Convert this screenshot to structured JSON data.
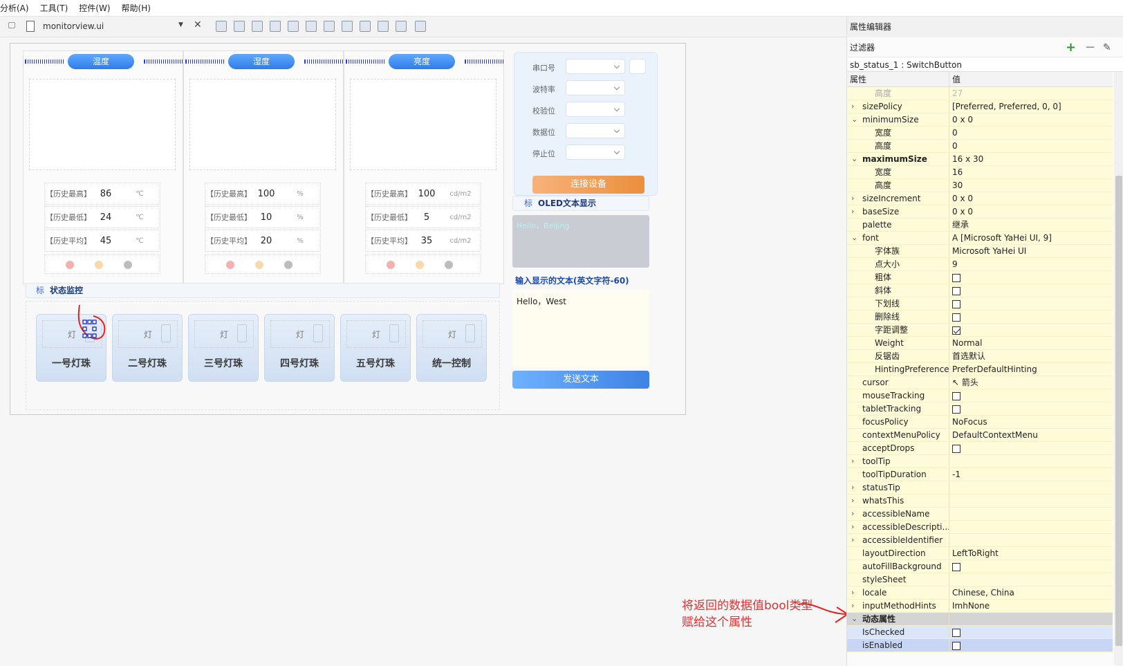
{
  "menu": [
    "分析(A)",
    "工具(T)",
    "控件(W)",
    "帮助(H)"
  ],
  "file": {
    "name": "monitorview.ui"
  },
  "cards": [
    {
      "title": "温度",
      "stats": [
        {
          "key": "【历史最高】",
          "value": "86",
          "unit": "℃"
        },
        {
          "key": "【历史最低】",
          "value": "24",
          "unit": "℃"
        },
        {
          "key": "【历史平均】",
          "value": "45",
          "unit": "℃"
        }
      ]
    },
    {
      "title": "湿度",
      "stats": [
        {
          "key": "【历史最高】",
          "value": "100",
          "unit": "%"
        },
        {
          "key": "【历史最低】",
          "value": "10",
          "unit": "%"
        },
        {
          "key": "【历史平均】",
          "value": "20",
          "unit": "%"
        }
      ]
    },
    {
      "title": "亮度",
      "stats": [
        {
          "key": "【历史最高】",
          "value": "100",
          "unit": "cd/m2"
        },
        {
          "key": "【历史最低】",
          "value": "5",
          "unit": "cd/m2"
        },
        {
          "key": "【历史平均】",
          "value": "35",
          "unit": "cd/m2"
        }
      ]
    }
  ],
  "dot_colors": [
    "#f3b0b0",
    "#f9d8ae",
    "#bdbdbd"
  ],
  "serial": {
    "labels": [
      "串口号",
      "波特率",
      "校验位",
      "数据位",
      "停止位"
    ],
    "connect": "连接设备"
  },
  "oled": {
    "title_icon": "标",
    "title": "OLED文本显示",
    "screen": "Hello，Beijing",
    "input_label": "输入显示的文本(英文字符-60)",
    "input_value": "Hello，West",
    "send": "发送文本"
  },
  "status": {
    "title_icon": "标",
    "title": "状态监控",
    "lamp_label": "灯",
    "buttons": [
      "一号灯珠",
      "二号灯珠",
      "三号灯珠",
      "四号灯珠",
      "五号灯珠",
      "统一控制"
    ]
  },
  "props": {
    "panel_title": "属性编辑器",
    "filter_label": "过滤器",
    "object": "sb_status_1 : SwitchButton",
    "col_name": "属性",
    "col_value": "值",
    "rows": [
      {
        "n": "高度",
        "v": "27",
        "ind": 2,
        "cb": "",
        "dim": true
      },
      {
        "n": "sizePolicy",
        "v": "[Preferred, Preferred, 0, 0]",
        "ind": 1,
        "arrow": "›",
        "cb": ""
      },
      {
        "n": "minimumSize",
        "v": "0 x 0",
        "ind": 1,
        "arrow": "⌄",
        "cb": ""
      },
      {
        "n": "宽度",
        "v": "0",
        "ind": 2,
        "cb": ""
      },
      {
        "n": "高度",
        "v": "0",
        "ind": 2,
        "cb": ""
      },
      {
        "n": "maximumSize",
        "v": "16 x 30",
        "ind": 1,
        "arrow": "⌄",
        "bold": true,
        "cb": ""
      },
      {
        "n": "宽度",
        "v": "16",
        "ind": 2,
        "cb": ""
      },
      {
        "n": "高度",
        "v": "30",
        "ind": 2,
        "cb": ""
      },
      {
        "n": "sizeIncrement",
        "v": "0 x 0",
        "ind": 1,
        "arrow": "›",
        "cb": ""
      },
      {
        "n": "baseSize",
        "v": "0 x 0",
        "ind": 1,
        "arrow": "›",
        "cb": ""
      },
      {
        "n": "palette",
        "v": "继承",
        "ind": 1,
        "cb": ""
      },
      {
        "n": "font",
        "v": "A  [Microsoft YaHei UI, 9]",
        "ind": 1,
        "arrow": "⌄",
        "cb": ""
      },
      {
        "n": "字体族",
        "v": "Microsoft YaHei UI",
        "ind": 2,
        "cb": ""
      },
      {
        "n": "点大小",
        "v": "9",
        "ind": 2,
        "cb": ""
      },
      {
        "n": "粗体",
        "v": "",
        "ind": 2,
        "cb": "off"
      },
      {
        "n": "斜体",
        "v": "",
        "ind": 2,
        "cb": "off"
      },
      {
        "n": "下划线",
        "v": "",
        "ind": 2,
        "cb": "off"
      },
      {
        "n": "删除线",
        "v": "",
        "ind": 2,
        "cb": "off"
      },
      {
        "n": "字距调整",
        "v": "",
        "ind": 2,
        "cb": "on"
      },
      {
        "n": "Weight",
        "v": "Normal",
        "ind": 2,
        "cb": ""
      },
      {
        "n": "反锯齿",
        "v": "首选默认",
        "ind": 2,
        "cb": ""
      },
      {
        "n": "HintingPreference",
        "v": "PreferDefaultHinting",
        "ind": 2,
        "cb": ""
      },
      {
        "n": "cursor",
        "v": "↖  箭头",
        "ind": 1,
        "cb": ""
      },
      {
        "n": "mouseTracking",
        "v": "",
        "ind": 1,
        "cb": "off"
      },
      {
        "n": "tabletTracking",
        "v": "",
        "ind": 1,
        "cb": "off"
      },
      {
        "n": "focusPolicy",
        "v": "NoFocus",
        "ind": 1,
        "cb": ""
      },
      {
        "n": "contextMenuPolicy",
        "v": "DefaultContextMenu",
        "ind": 1,
        "cb": ""
      },
      {
        "n": "acceptDrops",
        "v": "",
        "ind": 1,
        "cb": "off"
      },
      {
        "n": "toolTip",
        "v": "",
        "ind": 1,
        "arrow": "›",
        "cb": ""
      },
      {
        "n": "toolTipDuration",
        "v": "-1",
        "ind": 1,
        "cb": ""
      },
      {
        "n": "statusTip",
        "v": "",
        "ind": 1,
        "arrow": "›",
        "cb": ""
      },
      {
        "n": "whatsThis",
        "v": "",
        "ind": 1,
        "arrow": "›",
        "cb": ""
      },
      {
        "n": "accessibleName",
        "v": "",
        "ind": 1,
        "arrow": "›",
        "cb": ""
      },
      {
        "n": "accessibleDescripti...",
        "v": "",
        "ind": 1,
        "arrow": "›",
        "cb": ""
      },
      {
        "n": "accessibleIdentifier",
        "v": "",
        "ind": 1,
        "arrow": "›",
        "cb": ""
      },
      {
        "n": "layoutDirection",
        "v": "LeftToRight",
        "ind": 1,
        "cb": ""
      },
      {
        "n": "autoFillBackground",
        "v": "",
        "ind": 1,
        "cb": "off"
      },
      {
        "n": "styleSheet",
        "v": "",
        "ind": 1,
        "cb": ""
      },
      {
        "n": "locale",
        "v": "Chinese, China",
        "ind": 1,
        "arrow": "›",
        "cb": ""
      },
      {
        "n": "inputMethodHints",
        "v": "ImhNone",
        "ind": 1,
        "arrow": "›",
        "cb": ""
      },
      {
        "n": "动态属性",
        "v": "",
        "ind": 1,
        "arrow": "⌄",
        "bold": true,
        "group": true,
        "cb": ""
      },
      {
        "n": "IsChecked",
        "v": "",
        "ind": 1,
        "cb": "off",
        "blue": true
      },
      {
        "n": "isEnabled",
        "v": "",
        "ind": 1,
        "cb": "off",
        "blue2": true
      }
    ]
  },
  "annotation": [
    "将返回的数据值bool类型",
    "赋给这个属性"
  ]
}
